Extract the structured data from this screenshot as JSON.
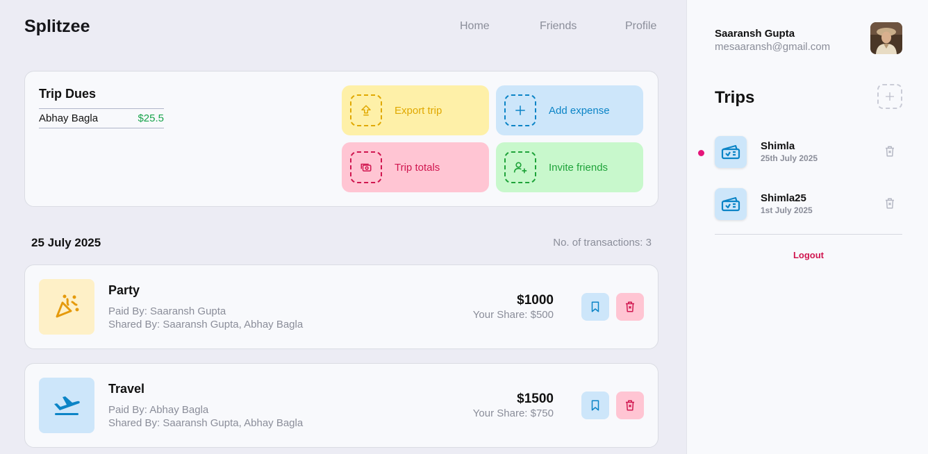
{
  "app": {
    "brand": "Splitzee"
  },
  "nav": {
    "home": "Home",
    "friends": "Friends",
    "profile": "Profile"
  },
  "dues": {
    "title": "Trip Dues",
    "items": [
      {
        "name": "Abhay Bagla",
        "amount": "$25.5"
      }
    ]
  },
  "actions": {
    "export": "Export trip",
    "add_expense": "Add expense",
    "totals": "Trip totals",
    "invite": "Invite friends"
  },
  "day": {
    "date": "25 July 2025",
    "count": "No. of transactions: 3"
  },
  "transactions": [
    {
      "name": "Party",
      "paid_by": "Paid By: Saaransh Gupta",
      "shared_by": "Shared By: Saaransh Gupta, Abhay Bagla",
      "amount": "$1000",
      "share": "Your Share: $500",
      "icon": "party-popper-icon"
    },
    {
      "name": "Travel",
      "paid_by": "Paid By: Abhay Bagla",
      "shared_by": "Shared By: Saaransh Gupta, Abhay Bagla",
      "amount": "$1500",
      "share": "Your Share: $750",
      "icon": "airplane-icon"
    }
  ],
  "user": {
    "name": "Saaransh Gupta",
    "email": "mesaaransh@gmail.com"
  },
  "trips": {
    "title": "Trips",
    "items": [
      {
        "name": "Shimla",
        "date": "25th July 2025",
        "active": true
      },
      {
        "name": "Shimla25",
        "date": "1st July 2025",
        "active": false
      }
    ]
  },
  "logout": "Logout",
  "colors": {
    "yellow_bg": "#FEF0A8",
    "yellow_fg": "#E0A800",
    "blue_bg": "#CDE6FA",
    "blue_fg": "#0B84C6",
    "pink_bg": "#FFC5D3",
    "pink_fg": "#D0164F",
    "green_bg": "#C8F8CC",
    "green_fg": "#1FA33A"
  }
}
